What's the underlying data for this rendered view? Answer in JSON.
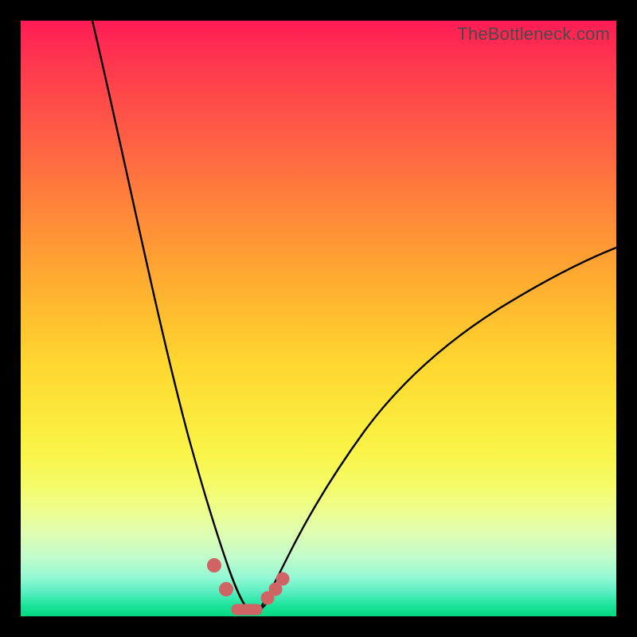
{
  "watermark": "TheBottleneck.com",
  "colors": {
    "frame": "#000000",
    "curve": "#000000",
    "beads": "#d06464"
  },
  "chart_data": {
    "type": "line",
    "title": "",
    "xlabel": "",
    "ylabel": "",
    "xlim": [
      0,
      100
    ],
    "ylim": [
      0,
      100
    ],
    "grid": false,
    "legend": null,
    "note": "No axes, ticks, or numeric labels are rendered; values are estimated from pixel positions on a 0–100 normalized scale.",
    "series": [
      {
        "name": "left-branch",
        "x": [
          12,
          14,
          16,
          18,
          20,
          22,
          24,
          26,
          28,
          30,
          32,
          34,
          35,
          36,
          37,
          38
        ],
        "y": [
          100,
          90,
          80,
          70,
          60,
          50,
          40,
          31,
          23,
          16,
          10,
          5.5,
          3.6,
          2.2,
          1.2,
          0.6
        ]
      },
      {
        "name": "right-branch",
        "x": [
          38,
          39,
          40,
          41,
          42,
          44,
          47,
          50,
          55,
          60,
          66,
          72,
          80,
          88,
          96,
          100
        ],
        "y": [
          0.6,
          0.9,
          1.5,
          2.4,
          3.6,
          6.2,
          10,
          14,
          20,
          25.5,
          31.5,
          37,
          43,
          48.5,
          53.5,
          56
        ]
      }
    ],
    "markers": [
      {
        "x": 32.5,
        "y": 8.5
      },
      {
        "x": 34.5,
        "y": 4.5
      },
      {
        "x": 41.5,
        "y": 3.0
      },
      {
        "x": 42.8,
        "y": 4.5
      },
      {
        "x": 44.0,
        "y": 6.2
      }
    ],
    "trough_segment": {
      "x0": 35.5,
      "x1": 40.5,
      "y": 0.9
    }
  }
}
